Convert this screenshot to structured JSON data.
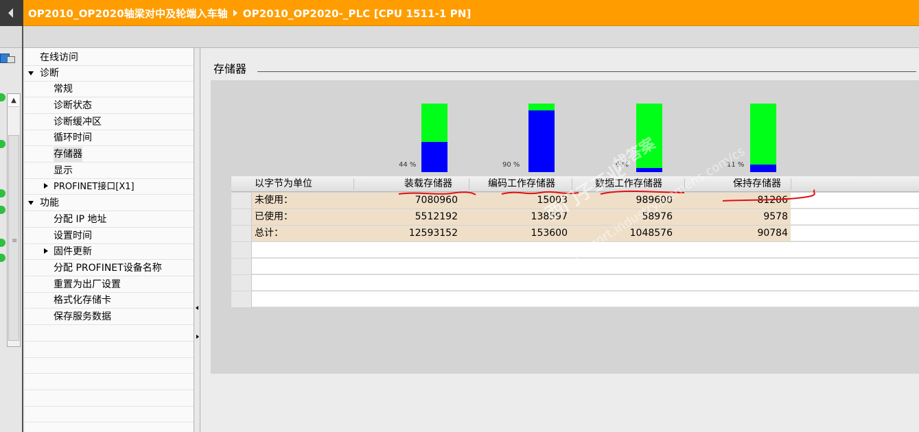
{
  "title_bar": {
    "project": "OP2010_OP2020轴梁对中及轮端入车轴",
    "device": "OP2010_OP2020-_PLC [CPU 1511-1 PN]"
  },
  "nav": {
    "items": [
      {
        "label": "在线访问"
      },
      {
        "label": "诊断"
      },
      {
        "label": "常规"
      },
      {
        "label": "诊断状态"
      },
      {
        "label": "诊断缓冲区"
      },
      {
        "label": "循环时间"
      },
      {
        "label": "存储器"
      },
      {
        "label": "显示"
      },
      {
        "label": "PROFINET接口[X1]"
      },
      {
        "label": "功能"
      },
      {
        "label": "分配 IP 地址"
      },
      {
        "label": "设置时间"
      },
      {
        "label": "固件更新"
      },
      {
        "label": "分配 PROFINET设备名称"
      },
      {
        "label": "重置为出厂设置"
      },
      {
        "label": "格式化存储卡"
      },
      {
        "label": "保存服务数据"
      }
    ]
  },
  "section": {
    "title": "存储器"
  },
  "chart": {
    "bars": [
      {
        "used_pct": 44,
        "label": "44 %"
      },
      {
        "used_pct": 90,
        "label": "90 %"
      },
      {
        "used_pct": 6,
        "label": "6 %"
      },
      {
        "used_pct": 11,
        "label": "11 %"
      }
    ],
    "colors": {
      "free": "#00ff18",
      "used": "#0000ff"
    }
  },
  "table": {
    "headers": [
      "以字节为单位",
      "装载存储器",
      "编码工作存储器",
      "数据工作存储器",
      "保持存储器"
    ],
    "rows": [
      {
        "label": "未使用：",
        "values": [
          "7080960",
          "15003",
          "989600",
          "81206"
        ]
      },
      {
        "label": "已使用：",
        "values": [
          "5512192",
          "138597",
          "58976",
          "9578"
        ]
      },
      {
        "label": "总计：",
        "values": [
          "12593152",
          "153600",
          "1048576",
          "90784"
        ]
      }
    ]
  },
  "watermark": {
    "line1": "西门子工业",
    "line2": "support.industry.siemens.com/cs",
    "line3": "找答案"
  }
}
